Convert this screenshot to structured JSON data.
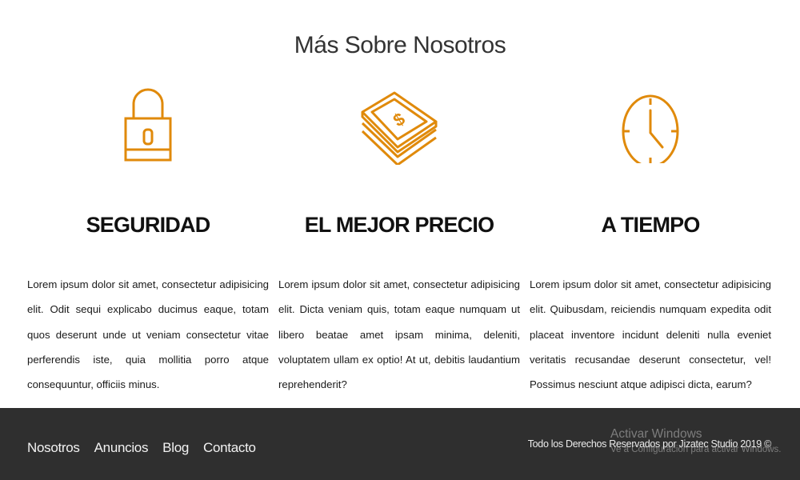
{
  "section": {
    "title": "Más Sobre Nosotros"
  },
  "features": [
    {
      "icon": "padlock-icon",
      "title": "SEGURIDAD",
      "text": "Lorem ipsum dolor sit amet, consectetur adipisicing elit. Odit sequi explicabo ducimus eaque, totam quos deserunt unde ut veniam consectetur vitae perferendis iste, quia mollitia porro atque consequuntur, officiis minus."
    },
    {
      "icon": "money-stack-icon",
      "title": "EL MEJOR PRECIO",
      "text": "Lorem ipsum dolor sit amet, consectetur adipisicing elit. Dicta veniam quis, totam eaque numquam ut libero beatae amet ipsam minima, deleniti, voluptatem ullam ex optio! At ut, debitis laudantium reprehenderit?"
    },
    {
      "icon": "clock-icon",
      "title": "A TIEMPO",
      "text": "Lorem ipsum dolor sit amet, consectetur adipisicing elit. Quibusdam, reiciendis numquam expedita odit placeat inventore incidunt deleniti nulla eveniet veritatis recusandae deserunt consectetur, vel! Possimus nesciunt atque adipisci dicta, earum?"
    }
  ],
  "colors": {
    "accent": "#e08a0b",
    "footer_bg": "#2f2f2f"
  },
  "footer": {
    "nav": [
      "Nosotros",
      "Anuncios",
      "Blog",
      "Contacto"
    ],
    "copyright": "Todo los Derechos Reservados por Jizatec Studio 2019 ©"
  },
  "watermark": {
    "title": "Activar Windows",
    "subtitle": "Ve a Configuración para activar Windows."
  }
}
